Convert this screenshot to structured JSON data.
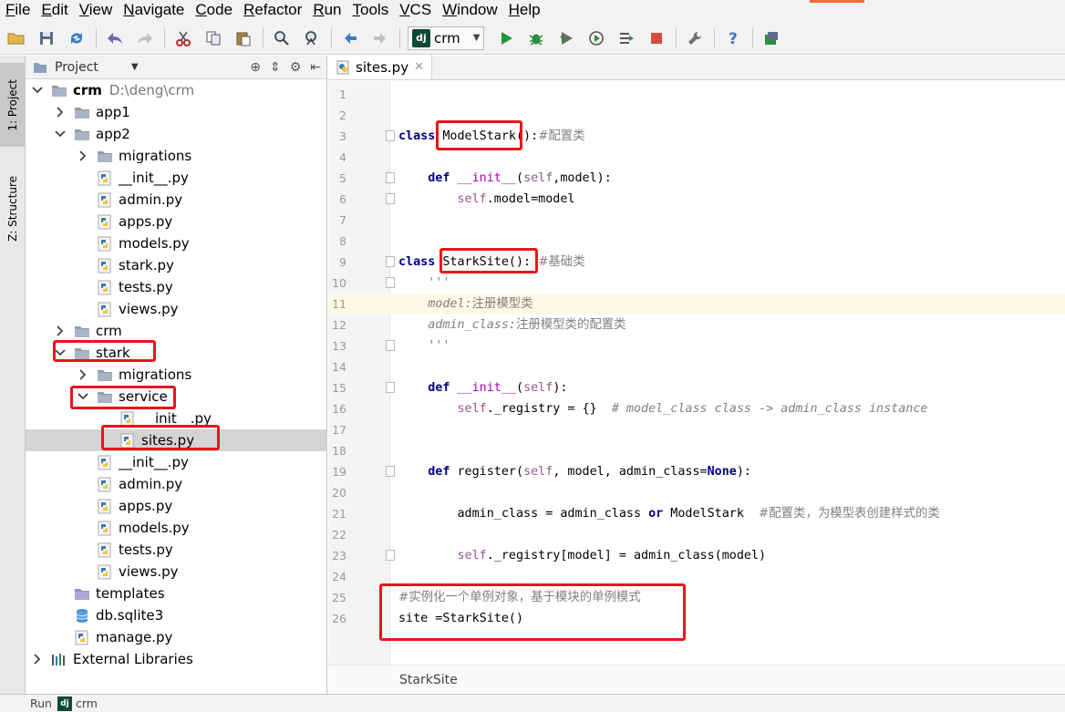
{
  "menu": {
    "items": [
      {
        "label": "File",
        "u": "F",
        "rest": "ile"
      },
      {
        "label": "Edit",
        "u": "E",
        "rest": "dit"
      },
      {
        "label": "View",
        "u": "V",
        "rest": "iew"
      },
      {
        "label": "Navigate",
        "u": "N",
        "rest": "avigate"
      },
      {
        "label": "Code",
        "u": "C",
        "rest": "ode"
      },
      {
        "label": "Refactor",
        "u": "R",
        "rest": "efactor"
      },
      {
        "label": "Run",
        "u": "R",
        "rest": "un"
      },
      {
        "label": "Tools",
        "u": "T",
        "rest": "ools"
      },
      {
        "label": "VCS",
        "u": "V",
        "rest": "CS"
      },
      {
        "label": "Window",
        "u": "W",
        "rest": "indow"
      },
      {
        "label": "Help",
        "u": "H",
        "rest": "elp"
      }
    ]
  },
  "toolbar": {
    "run_config": "crm",
    "dj_badge": "dj"
  },
  "left_strip": {
    "project_tab": "1: Project",
    "structure_tab": "Z: Structure"
  },
  "project_panel": {
    "title": "Project",
    "tree": [
      {
        "label": "crm",
        "path": "D:\\deng\\crm",
        "indent": 0,
        "arrow": "down",
        "icon": "folder",
        "bold": true
      },
      {
        "label": "app1",
        "indent": 1,
        "arrow": "right",
        "icon": "folder"
      },
      {
        "label": "app2",
        "indent": 1,
        "arrow": "down",
        "icon": "folder"
      },
      {
        "label": "migrations",
        "indent": 2,
        "arrow": "right",
        "icon": "folder"
      },
      {
        "label": "__init__.py",
        "indent": 2,
        "arrow": "none",
        "icon": "python"
      },
      {
        "label": "admin.py",
        "indent": 2,
        "arrow": "none",
        "icon": "python"
      },
      {
        "label": "apps.py",
        "indent": 2,
        "arrow": "none",
        "icon": "python"
      },
      {
        "label": "models.py",
        "indent": 2,
        "arrow": "none",
        "icon": "python"
      },
      {
        "label": "stark.py",
        "indent": 2,
        "arrow": "none",
        "icon": "python"
      },
      {
        "label": "tests.py",
        "indent": 2,
        "arrow": "none",
        "icon": "python"
      },
      {
        "label": "views.py",
        "indent": 2,
        "arrow": "none",
        "icon": "python"
      },
      {
        "label": "crm",
        "indent": 1,
        "arrow": "right",
        "icon": "folder"
      },
      {
        "label": "stark",
        "indent": 1,
        "arrow": "down",
        "icon": "folder"
      },
      {
        "label": "migrations",
        "indent": 2,
        "arrow": "right",
        "icon": "folder"
      },
      {
        "label": "service",
        "indent": 2,
        "arrow": "down",
        "icon": "folder"
      },
      {
        "label": "__init__.py",
        "indent": 3,
        "arrow": "none",
        "icon": "python"
      },
      {
        "label": "sites.py",
        "indent": 3,
        "arrow": "none",
        "icon": "python",
        "selected": true
      },
      {
        "label": "__init__.py",
        "indent": 2,
        "arrow": "none",
        "icon": "python"
      },
      {
        "label": "admin.py",
        "indent": 2,
        "arrow": "none",
        "icon": "python"
      },
      {
        "label": "apps.py",
        "indent": 2,
        "arrow": "none",
        "icon": "python"
      },
      {
        "label": "models.py",
        "indent": 2,
        "arrow": "none",
        "icon": "python"
      },
      {
        "label": "tests.py",
        "indent": 2,
        "arrow": "none",
        "icon": "python"
      },
      {
        "label": "views.py",
        "indent": 2,
        "arrow": "none",
        "icon": "python"
      },
      {
        "label": "templates",
        "indent": 1,
        "arrow": "none",
        "icon": "folder-purple"
      },
      {
        "label": "db.sqlite3",
        "indent": 1,
        "arrow": "none",
        "icon": "db"
      },
      {
        "label": "manage.py",
        "indent": 1,
        "arrow": "none",
        "icon": "python"
      },
      {
        "label": "External Libraries",
        "indent": 0,
        "arrow": "right",
        "icon": "libs"
      }
    ]
  },
  "editor": {
    "tab_label": "sites.py",
    "lines": [
      {
        "n": "1",
        "t": []
      },
      {
        "n": "2",
        "t": []
      },
      {
        "n": "3",
        "fold": true,
        "t": [
          [
            "k",
            "class"
          ],
          [
            "n",
            " ModelStark():"
          ],
          [
            "cmt-cn",
            "#配置类"
          ]
        ]
      },
      {
        "n": "4",
        "t": []
      },
      {
        "n": "5",
        "fold": true,
        "t": [
          [
            "n",
            "    "
          ],
          [
            "k",
            "def"
          ],
          [
            "n",
            " "
          ],
          [
            "fn",
            "__init__"
          ],
          [
            "n",
            "("
          ],
          [
            "s",
            "self"
          ],
          [
            "n",
            ",model):"
          ]
        ]
      },
      {
        "n": "6",
        "fold": true,
        "t": [
          [
            "n",
            "        "
          ],
          [
            "s",
            "self"
          ],
          [
            "n",
            ".model=model"
          ]
        ]
      },
      {
        "n": "7",
        "t": []
      },
      {
        "n": "8",
        "t": []
      },
      {
        "n": "9",
        "fold": true,
        "t": [
          [
            "k",
            "class"
          ],
          [
            "n",
            " StarkSite(): "
          ],
          [
            "cmt-cn",
            "#基础类"
          ]
        ]
      },
      {
        "n": "10",
        "fold": true,
        "t": [
          [
            "n",
            "    "
          ],
          [
            "doc",
            "'''"
          ]
        ]
      },
      {
        "n": "11",
        "current": true,
        "t": [
          [
            "n",
            "    "
          ],
          [
            "doc",
            "model:"
          ],
          [
            "cmt-cn",
            "注册模型类"
          ]
        ]
      },
      {
        "n": "12",
        "t": [
          [
            "n",
            "    "
          ],
          [
            "doc",
            "admin_class:"
          ],
          [
            "cmt-cn",
            "注册模型类的配置类"
          ]
        ]
      },
      {
        "n": "13",
        "fold": true,
        "t": [
          [
            "n",
            "    "
          ],
          [
            "doc",
            "'''"
          ]
        ]
      },
      {
        "n": "14",
        "t": []
      },
      {
        "n": "15",
        "fold": true,
        "t": [
          [
            "n",
            "    "
          ],
          [
            "k",
            "def"
          ],
          [
            "n",
            " "
          ],
          [
            "fn",
            "__init__"
          ],
          [
            "n",
            "("
          ],
          [
            "s",
            "self"
          ],
          [
            "n",
            "):"
          ]
        ]
      },
      {
        "n": "16",
        "t": [
          [
            "n",
            "        "
          ],
          [
            "s",
            "self"
          ],
          [
            "n",
            "._registry = {}  "
          ],
          [
            "c",
            "# model_class class -> admin_class instance"
          ]
        ]
      },
      {
        "n": "17",
        "t": []
      },
      {
        "n": "18",
        "t": []
      },
      {
        "n": "19",
        "fold": true,
        "t": [
          [
            "n",
            "    "
          ],
          [
            "k",
            "def"
          ],
          [
            "n",
            " register("
          ],
          [
            "s",
            "self"
          ],
          [
            "n",
            ", model, admin_class="
          ],
          [
            "k",
            "None"
          ],
          [
            "n",
            "):"
          ]
        ]
      },
      {
        "n": "20",
        "t": []
      },
      {
        "n": "21",
        "t": [
          [
            "n",
            "        admin_class = admin_class "
          ],
          [
            "k",
            "or"
          ],
          [
            "n",
            " ModelStark  "
          ],
          [
            "cmt-cn",
            "#配置类，为模型表创建样式的类"
          ]
        ]
      },
      {
        "n": "22",
        "t": []
      },
      {
        "n": "23",
        "fold": true,
        "t": [
          [
            "n",
            "        "
          ],
          [
            "s",
            "self"
          ],
          [
            "n",
            "._registry[model] = admin_class(model)"
          ]
        ]
      },
      {
        "n": "24",
        "t": []
      },
      {
        "n": "25",
        "t": [
          [
            "cmt-cn",
            "#实例化一个单例对象，基于模块的单例模式"
          ]
        ]
      },
      {
        "n": "26",
        "t": [
          [
            "n",
            "site =StarkSite()"
          ]
        ]
      }
    ],
    "breadcrumb": "StarkSite"
  },
  "status": {
    "run_label": "Run",
    "config": "crm"
  }
}
